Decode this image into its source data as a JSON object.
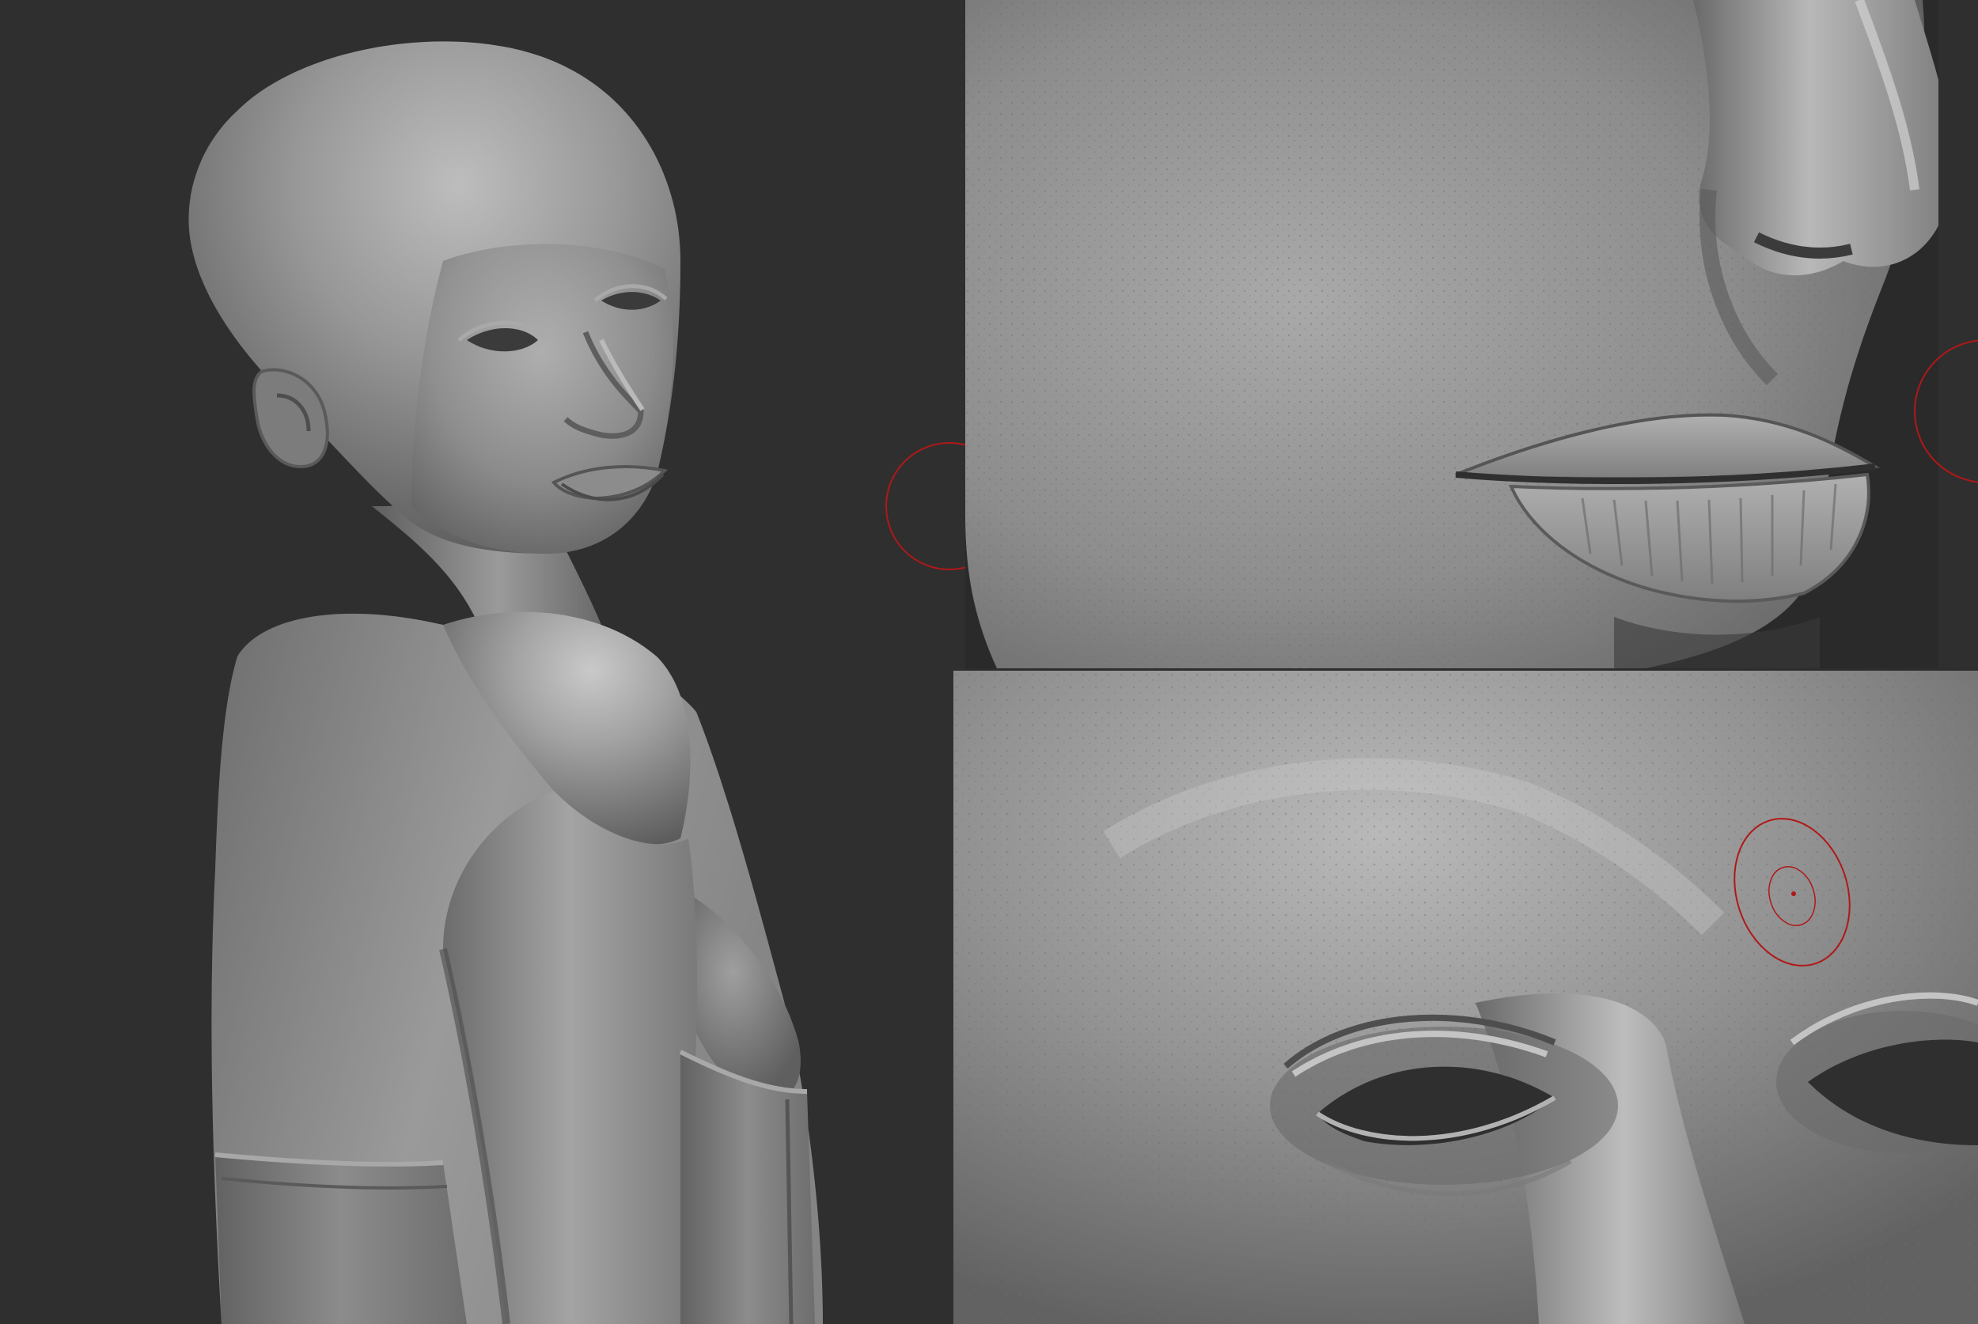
{
  "viewport": {
    "background_color": "#2d2d2d",
    "clay_base_color": "#8a8a8a",
    "clay_highlight_color": "#c4c4c4",
    "clay_shadow_color": "#4a4a4a",
    "brush_cursor_color": "#b01818"
  },
  "panels": [
    {
      "subject": "bald-female-bust-sculpt"
    },
    {
      "subject": "nose-and-lips-closeup"
    },
    {
      "subject": "eyes-and-nose-bridge-closeup"
    }
  ],
  "brush_cursors": [
    {
      "panel": "bust",
      "visible": true
    },
    {
      "panel": "mouth",
      "visible": true
    },
    {
      "panel": "eyes",
      "visible": true
    }
  ]
}
